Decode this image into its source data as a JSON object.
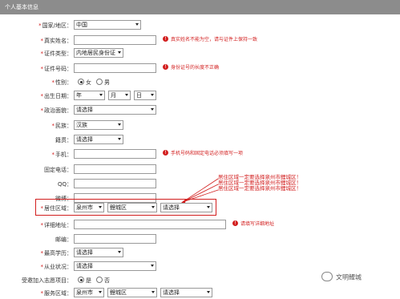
{
  "header": {
    "title": "个人基本信息"
  },
  "fields": {
    "country": {
      "label": "国家/地区：",
      "value": "中国"
    },
    "name": {
      "label": "真实姓名：",
      "value": "",
      "error": "真实姓名不能为空，请与证件上保持一致"
    },
    "id_type": {
      "label": "证件类型：",
      "value": "内地居民身份证"
    },
    "id_number": {
      "label": "证件号码：",
      "value": "",
      "error": "身份证号的长度不正确"
    },
    "gender": {
      "label": "性别：",
      "options": [
        "女",
        "男"
      ],
      "selected": "女"
    },
    "birth": {
      "label": "出生日期：",
      "year": "年",
      "month": "月",
      "day": "日"
    },
    "politics": {
      "label": "政治面貌：",
      "value": "请选择"
    },
    "ethnicity": {
      "label": "民族：",
      "value": "汉族"
    },
    "native_place": {
      "label": "籍贯：",
      "value": "请选择"
    },
    "mobile": {
      "label": "手机：",
      "value": "",
      "error": "手机号码和固定电话必须填写一项"
    },
    "phone": {
      "label": "固定电话：",
      "value": ""
    },
    "qq": {
      "label": "QQ：",
      "value": ""
    },
    "weibo": {
      "label": "微博：",
      "value": ""
    },
    "residence": {
      "label": "居住区域：",
      "city": "泉州市",
      "district": "鲤城区",
      "street": "请选择"
    },
    "address": {
      "label": "详细地址：",
      "value": "",
      "error": "请填写详细地址"
    },
    "postcode": {
      "label": "邮编：",
      "value": ""
    },
    "education": {
      "label": "最高学历：",
      "value": "请选择"
    },
    "employment": {
      "label": "从业状况：",
      "value": "请选择"
    },
    "joined": {
      "label": "受邀加入志愿项目：",
      "options": [
        "是",
        "否"
      ],
      "selected": "是"
    },
    "service_area": {
      "label": "服务区域：",
      "city": "泉州市",
      "district": "鲤城区",
      "street": "请选择"
    }
  },
  "annotation": {
    "lines": [
      "居住区域一定要选择泉州市鲤城区！",
      "居住区域一定要选择泉州市鲤城区！",
      "居住区域一定要选择泉州市鲤城区！"
    ]
  },
  "watermark": {
    "text": "文明鲤城"
  },
  "colors": {
    "header_bg": "#8c8c8c",
    "error": "#d21e1e"
  },
  "icons": {
    "error": "exclamation-circle-icon",
    "watermark": "wechat-logo-icon"
  }
}
